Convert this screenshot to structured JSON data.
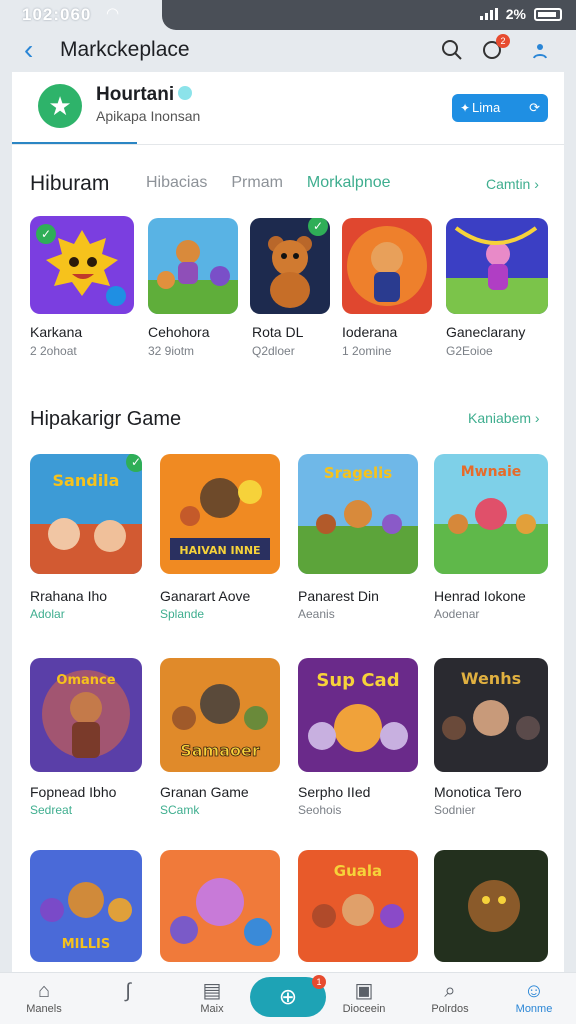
{
  "status": {
    "time": "102:060",
    "battery_text": "2%"
  },
  "header": {
    "title": "Markckeplace",
    "notification_count": "2"
  },
  "profile": {
    "name": "Hourtani",
    "subtitle": "Apikapa Inonsan",
    "button_label": "Lima"
  },
  "hiburam": {
    "title": "Hiburam",
    "tabs": [
      "Hibacias",
      "Prmam",
      "Morkalpnoe"
    ],
    "active_tab": "Morkalpnoe",
    "more_label": "Camtin",
    "items": [
      {
        "name": "Karkana",
        "sub": "2 2ohoat"
      },
      {
        "name": "Cehohora",
        "sub": "32 9iotm"
      },
      {
        "name": "Rota DL",
        "sub": "Q2dloer"
      },
      {
        "name": "Ioderana",
        "sub": "1 2omine"
      },
      {
        "name": "Ganeclarany",
        "sub": "G2Eoioe"
      }
    ]
  },
  "hipakarigr": {
    "title": "Hipakarigr Game",
    "more_label": "Kaniabem",
    "rows": [
      [
        {
          "name": "Rrahana Iho",
          "sub": "Adolar",
          "art_text": "Sandila"
        },
        {
          "name": "Ganarart Aove",
          "sub": "Splande",
          "art_text": "HAIVAN INNE"
        },
        {
          "name": "Panarest Din",
          "sub": "Aeanis",
          "art_text": "Sragelis"
        },
        {
          "name": "Henrad Iokone",
          "sub": "Aodenar",
          "art_text": "Mwnaie"
        }
      ],
      [
        {
          "name": "Fopnead Ibho",
          "sub": "Sedreat",
          "art_text": "Omance"
        },
        {
          "name": "Granan Game",
          "sub": "SCamk",
          "art_text": "Samaoer"
        },
        {
          "name": "Serpho IIed",
          "sub": "Seohois",
          "art_text": "Sup Cad"
        },
        {
          "name": "Monotica Tero",
          "sub": "Sodnier",
          "art_text": "Wenhs"
        }
      ],
      [
        {
          "name": "",
          "sub": "",
          "art_text": "MILLIS"
        },
        {
          "name": "",
          "sub": "",
          "art_text": ""
        },
        {
          "name": "",
          "sub": "",
          "art_text": "Guala"
        },
        {
          "name": "",
          "sub": "",
          "art_text": ""
        }
      ]
    ]
  },
  "nav": {
    "items": [
      "Manels",
      "",
      "Maix",
      "",
      "Dioceein",
      "Polrdos",
      "Monme"
    ],
    "fab_badge": "1"
  },
  "colors": {
    "accent_green": "#3fae8f",
    "brand_blue": "#2a86d6",
    "fab": "#1ea3b5"
  }
}
